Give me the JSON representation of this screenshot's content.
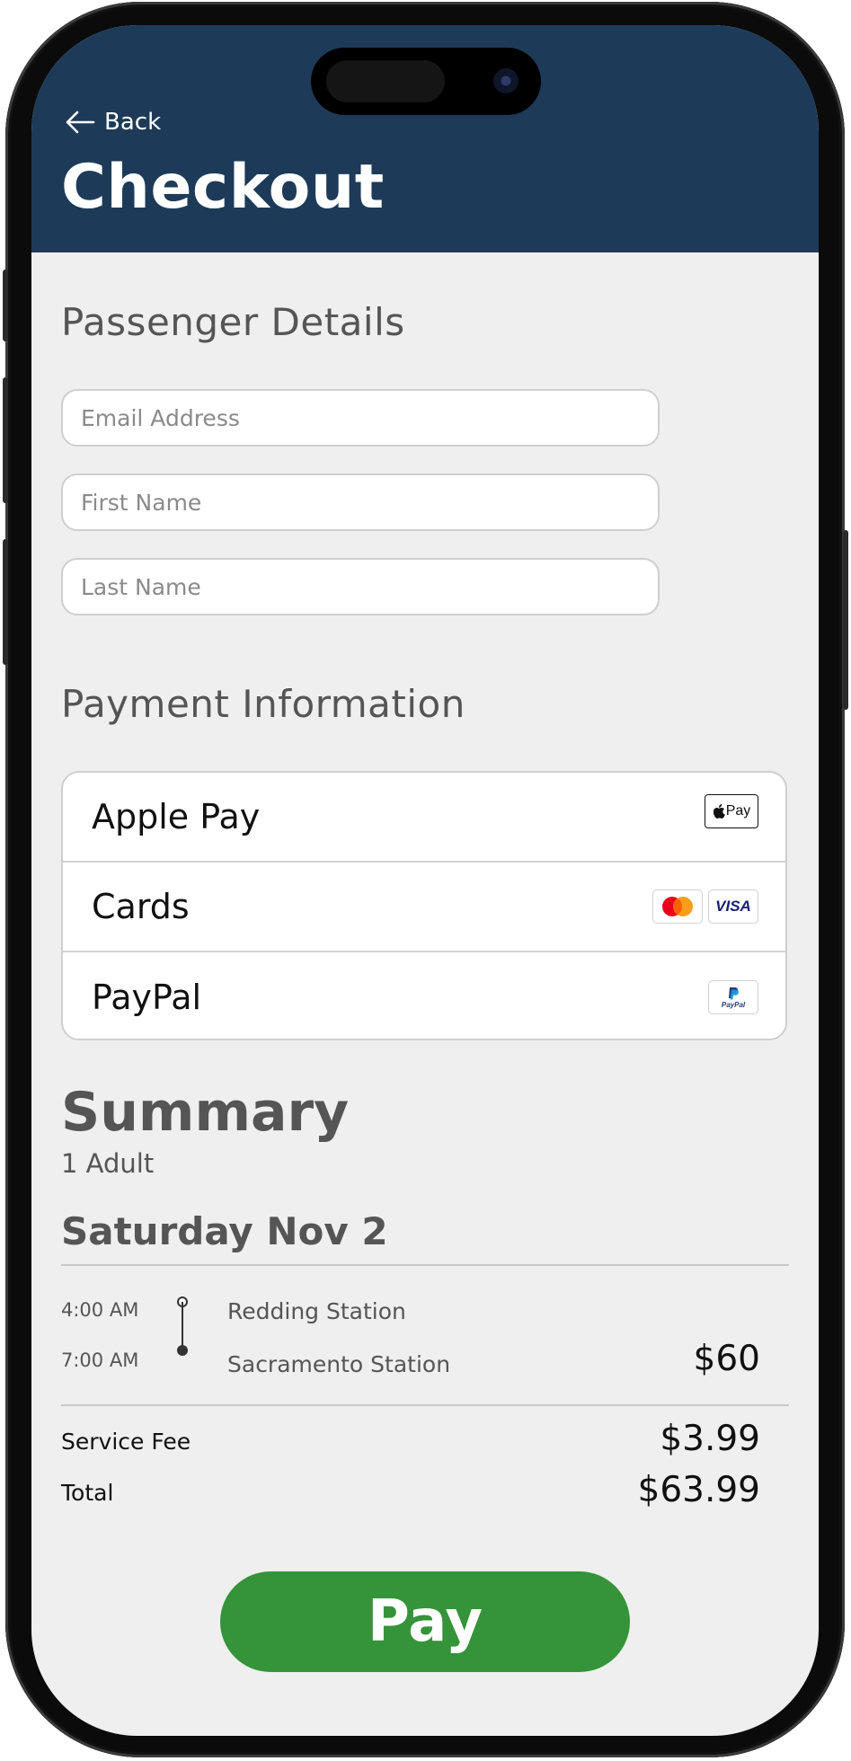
{
  "header": {
    "back_label": "Back",
    "title": "Checkout",
    "background_color": "#1d3b58"
  },
  "passenger": {
    "section_title": "Passenger Details",
    "email_placeholder": "Email Address",
    "first_name_placeholder": "First Name",
    "last_name_placeholder": "Last Name"
  },
  "payment": {
    "section_title": "Payment Information",
    "methods": [
      {
        "label": "Apple Pay",
        "icons": [
          "apple-pay-icon"
        ]
      },
      {
        "label": "Cards",
        "icons": [
          "mastercard-icon",
          "visa-icon"
        ]
      },
      {
        "label": "PayPal",
        "icons": [
          "paypal-icon"
        ]
      }
    ],
    "apple_pay_logo_text": "Pay",
    "visa_logo_text": "VISA",
    "paypal_logo_text": "PayPal"
  },
  "summary": {
    "title": "Summary",
    "passengers": "1 Adult",
    "date": "Saturday Nov 2",
    "departure_time": "4:00 AM",
    "arrival_time": "7:00 AM",
    "origin": "Redding Station",
    "destination": "Sacramento Station",
    "fare": "$60",
    "service_fee_label": "Service Fee",
    "service_fee": "$3.99",
    "total_label": "Total",
    "total": "$63.99"
  },
  "pay_button": {
    "label": "Pay",
    "color": "#359339"
  }
}
